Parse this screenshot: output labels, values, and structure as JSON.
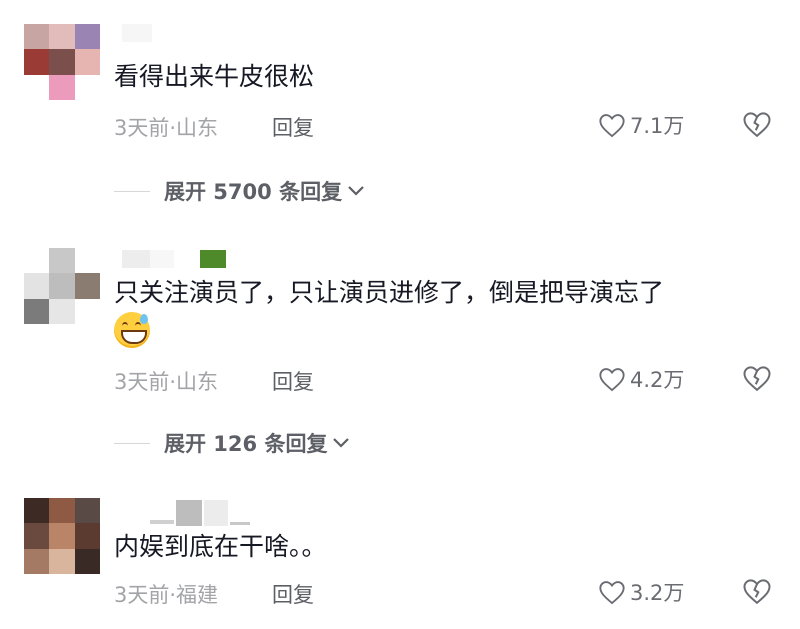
{
  "comments": [
    {
      "text": "看得出来牛皮很松",
      "time": "3天前·山东",
      "reply_label": "回复",
      "likes": "7.1万",
      "expand_label": "展开 5700 条回复"
    },
    {
      "text": "只关注演员了，只让演员进修了，倒是把导演忘了",
      "emoji": "grinning-sweat-emoji",
      "time": "3天前·山东",
      "reply_label": "回复",
      "likes": "4.2万",
      "expand_label": "展开 126 条回复"
    },
    {
      "text": "内娱到底在干啥。。",
      "time": "3天前·福建",
      "reply_label": "回复",
      "likes": "3.2万"
    }
  ],
  "icons": {
    "like": "heart-outline-icon",
    "dislike": "broken-heart-icon",
    "expand": "chevron-down-icon"
  },
  "colors": {
    "text": "#161823",
    "meta": "#a3a4a8",
    "action": "#5d5f66"
  }
}
